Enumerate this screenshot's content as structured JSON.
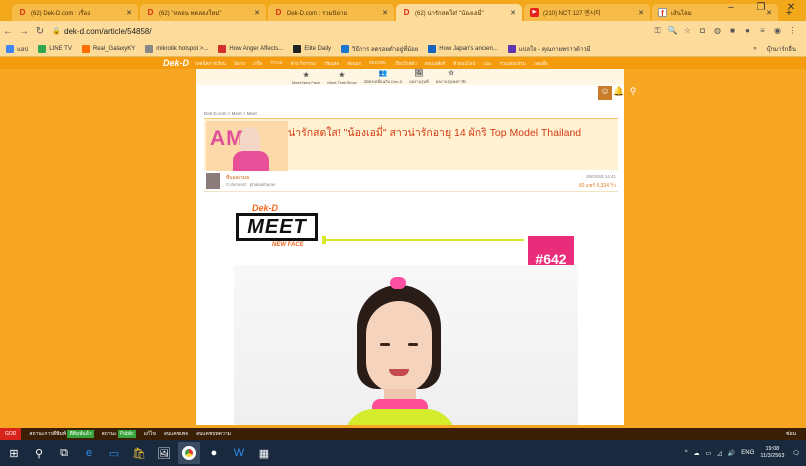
{
  "browser": {
    "tabs": [
      {
        "title": "(62) Dek-D.com : เรื่อง",
        "icon": "D",
        "active": false
      },
      {
        "title": "(62) \"หลอน ทดลองใหม่\"",
        "icon": "D",
        "active": false
      },
      {
        "title": "Dek-D.com : รวมนิยาย",
        "icon": "D",
        "active": false
      },
      {
        "title": "(62) น่ารักสดใส! \"น้องเอมี่\"",
        "icon": "D",
        "active": true
      },
      {
        "title": "(210) NCT 127 엔시티",
        "icon": "▶",
        "active": false
      },
      {
        "title": "เส้นโลม",
        "icon": "f",
        "active": false
      }
    ],
    "url": "dek-d.com/article/54858/",
    "bookmarks": [
      {
        "label": "แอป",
        "color": "#4285f4"
      },
      {
        "label": "LINE TV",
        "color": "#2fa84f"
      },
      {
        "label": "Real_GalaxyKY",
        "color": "#ff6d00"
      },
      {
        "label": "mikrotik hotspot >...",
        "color": "#888888"
      },
      {
        "label": "How Anger Affects...",
        "color": "#d32f2f"
      },
      {
        "label": "Elite Daily",
        "color": "#222222"
      },
      {
        "label": "วิธีการ ลดรอยดำอยู่ที่ม้อย",
        "color": "#1976d2"
      },
      {
        "label": "How Japan's ancien...",
        "color": "#1565c0"
      },
      {
        "label": "แปลใจ - คุณกายพราวด้าวมี",
        "color": "#5e35b1"
      }
    ],
    "bookmarks_more": "»",
    "bookmarks_other": "บุ๊กมาร์กอื่น"
  },
  "site": {
    "logo": "Dek-D",
    "menu": [
      "เทคนิคการเรียน",
      "นิยาย",
      "เกร็ด",
      "TCAS",
      "ค่าย กิจกรรม",
      "เรียนต่อ",
      "ต่อนอก",
      "MUGIRL",
      "เรื่องใกล้ตัว",
      "สอบเพลียร์",
      "ติวออนไลน์",
      "แนะ",
      "รวมเทอมรรม",
      "เจอเดี้ย"
    ],
    "icon_nav": [
      {
        "icon": "★",
        "label": "Meet-New Face"
      },
      {
        "icon": "★",
        "label": "Meet-TheirShow"
      },
      {
        "icon": "👥",
        "label": "สมัครเหลื่อนกับ Dek-D"
      },
      {
        "icon": "🖼",
        "label": "ผลงานรุ่นพี่"
      },
      {
        "icon": "☆",
        "label": "ผลงานรุ่นพงกาสัก"
      }
    ],
    "breadcrumb": "Dek-D.com > Meet > Meet"
  },
  "article": {
    "title": "น่ารักสดใส! \"น้องเอมี่\" สาวน่ารักอายุ 14 ผักริ Top Model Thailand",
    "thumb_overlay": "AMY",
    "author_name": "พี่บอสเรมย",
    "author_column": "Columnist : phakakhaow",
    "date": "28/02/63 14:41",
    "stats": "60 แชร์  5,334 วิว",
    "meet_dek": "Dek-D",
    "meet_title": "MEET",
    "meet_sub": "NEW FACE",
    "issue": "#642"
  },
  "statusbar": {
    "god": "GOD",
    "items": [
      {
        "label": "สถานะการตีพิมพ์",
        "tag": "ตีพิมพ์แล้ว"
      },
      {
        "label": "สถานะ",
        "tag": "Public"
      },
      {
        "label": "แก้ไข",
        "tag": ""
      },
      {
        "label": "ลบแคชเพจ",
        "tag": ""
      },
      {
        "label": "ลบแคชบทความ",
        "tag": ""
      }
    ],
    "end": "ซ่อน"
  },
  "taskbar": {
    "lang": "ENG",
    "time": "19:08",
    "date": "11/3/2563"
  }
}
